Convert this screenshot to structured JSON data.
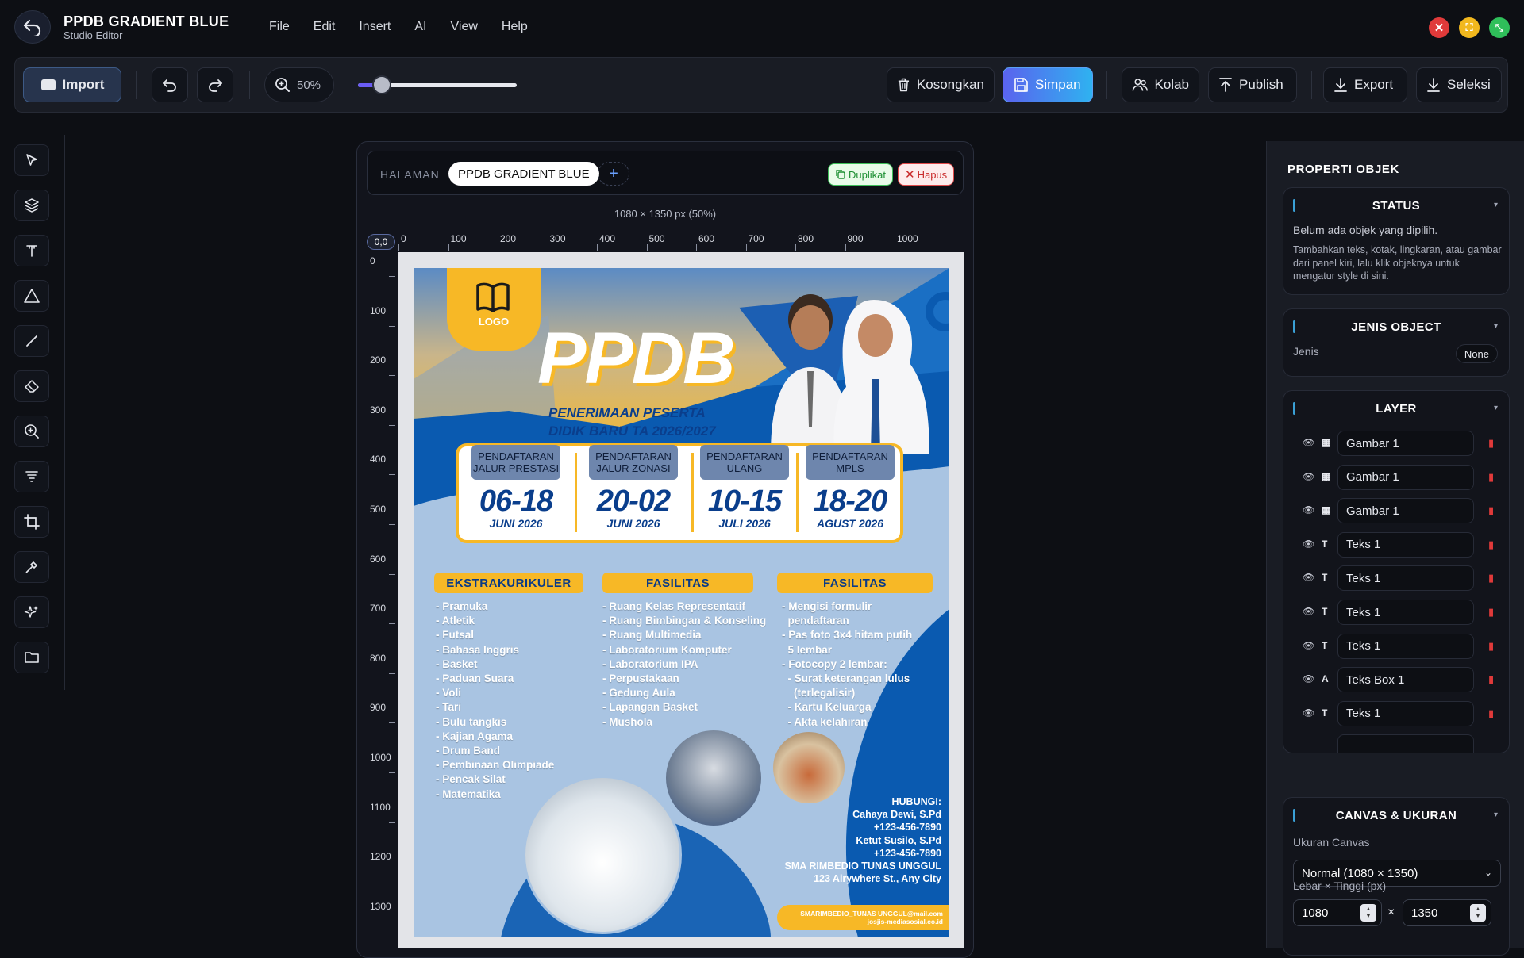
{
  "app": {
    "title": "PPDB GRADIENT BLUE",
    "subtitle": "Studio Editor"
  },
  "menu": [
    "File",
    "Edit",
    "Insert",
    "AI",
    "View",
    "Help"
  ],
  "window_controls": {
    "close_color": "#e03a3a",
    "min_color": "#f2b81e",
    "max_color": "#2fbf5a"
  },
  "toolbar": {
    "import_label": "Import",
    "zoom_label": "50%",
    "zoom_value": 0.5,
    "zoom_slider_fraction": 0.15,
    "clear_label": "Kosongkan",
    "save_label": "Simpan",
    "collab_label": "Kolab",
    "publish_label": "Publish",
    "export_label": "Export",
    "select_label": "Seleksi"
  },
  "pages": {
    "label": "HALAMAN",
    "current": "PPDB GRADIENT BLUE",
    "add": "+",
    "duplicate_label": "Duplikat",
    "delete_label": "Hapus"
  },
  "canvas": {
    "dims_label": "1080 × 1350 px (50%)",
    "origin_label": "0,0",
    "ruler_x": [
      "0",
      "100",
      "200",
      "300",
      "400",
      "500",
      "600",
      "700",
      "800",
      "900",
      "1000"
    ],
    "ruler_y": [
      "0",
      "100",
      "200",
      "300",
      "400",
      "500",
      "600",
      "700",
      "800",
      "900",
      "1000",
      "1100",
      "1200",
      "1300"
    ]
  },
  "poster": {
    "logo_text": "LOGO",
    "headline": "PPDB",
    "subline1": "PENERIMAAN PESERTA",
    "subline2": "DIDIK BARU TA 2026/2027",
    "dates": [
      {
        "label": "PENDAFTARAN\nJALUR PRESTASI",
        "days": "06-18",
        "month": "JUNI 2026"
      },
      {
        "label": "PENDAFTARAN\nJALUR ZONASI",
        "days": "20-02",
        "month": "JUNI 2026"
      },
      {
        "label": "PENDAFTARAN\nULANG",
        "days": "10-15",
        "month": "JULI 2026"
      },
      {
        "label": "PENDAFTARAN\nMPLS",
        "days": "18-20",
        "month": "AGUST 2026"
      }
    ],
    "sections": {
      "ekskul_title": "EKSTRAKURIKULER",
      "ekskul": [
        "- Pramuka",
        "- Atletik",
        "- Futsal",
        "- Bahasa Inggris",
        "- Basket",
        "- Paduan Suara",
        "- Voli",
        "- Tari",
        "- Bulu tangkis",
        "- Kajian Agama",
        "- Drum Band",
        "- Pembinaan Olimpiade",
        "- Pencak Silat",
        "- Matematika"
      ],
      "fasilitas_title": "FASILITAS",
      "fasilitas": [
        "- Ruang Kelas Representatif",
        "- Ruang Bimbingan & Konseling",
        "- Ruang Multimedia",
        "- Laboratorium Komputer",
        "- Laboratorium IPA",
        "- Perpustakaan",
        "- Gedung Aula",
        "- Lapangan Basket",
        "- Mushola"
      ],
      "syarat_title": "FASILITAS",
      "syarat": [
        "- Mengisi formulir",
        "  pendaftaran",
        "- Pas foto 3x4 hitam putih",
        "  5 lembar",
        "- Fotocopy 2 lembar:",
        "  - Surat keterangan lulus",
        "    (terlegalisir)",
        "  - Kartu Keluarga",
        "  - Akta kelahiran"
      ]
    },
    "contact": [
      "HUBUNGI:",
      "Cahaya Dewi, S.Pd",
      "+123-456-7890",
      "Ketut Susilo, S.Pd",
      "+123-456-7890",
      "SMA RIMBEDIO TUNAS UNGGUL",
      "123 Airywhere St., Any City"
    ],
    "footer_line1": "SMARIMBEDIO_TUNAS UNGGUL@mail.com",
    "footer_line2": "josjis-mediasosial.co.id",
    "colors": {
      "blue": "#0a5ab0",
      "yellow": "#f7b826",
      "navy": "#0a3e8c"
    }
  },
  "properties": {
    "title": "PROPERTI OBJEK",
    "status": {
      "title": "STATUS",
      "line1": "Belum ada objek yang dipilih.",
      "line2": "Tambahkan teks, kotak, lingkaran, atau gambar dari panel kiri, lalu klik objeknya untuk mengatur style di sini."
    },
    "jenis": {
      "title": "JENIS OBJECT",
      "label": "Jenis",
      "value": "None"
    },
    "layer": {
      "title": "LAYER",
      "items": [
        {
          "type_icon": "image-icon",
          "glyph": "▦",
          "name": "Gambar 1"
        },
        {
          "type_icon": "image-icon",
          "glyph": "▦",
          "name": "Gambar 1"
        },
        {
          "type_icon": "image-icon",
          "glyph": "▦",
          "name": "Gambar 1"
        },
        {
          "type_icon": "text-icon",
          "glyph": "T",
          "name": "Teks 1"
        },
        {
          "type_icon": "text-icon",
          "glyph": "T",
          "name": "Teks 1"
        },
        {
          "type_icon": "text-icon",
          "glyph": "T",
          "name": "Teks 1"
        },
        {
          "type_icon": "text-icon",
          "glyph": "T",
          "name": "Teks 1"
        },
        {
          "type_icon": "textbox-icon",
          "glyph": "A",
          "name": "Teks Box 1"
        },
        {
          "type_icon": "text-icon",
          "glyph": "T",
          "name": "Teks 1"
        }
      ]
    },
    "canvas_size": {
      "title": "CANVAS & UKURAN",
      "size_label": "Ukuran Canvas",
      "size_value": "Normal (1080 × 1350)",
      "wh_label": "Lebar × Tinggi (px)",
      "width": "1080",
      "height": "1350",
      "times": "×"
    }
  }
}
